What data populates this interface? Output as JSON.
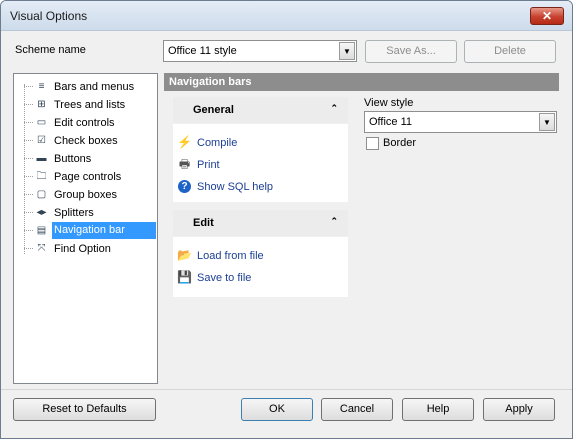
{
  "window": {
    "title": "Visual Options",
    "close_glyph": "✕"
  },
  "scheme": {
    "label": "Scheme name",
    "value": "Office 11 style",
    "save_as_label": "Save As...",
    "delete_label": "Delete"
  },
  "tree": {
    "items": [
      {
        "label": "Bars and menus",
        "icon": "bars-menus-icon",
        "glyph": "≡"
      },
      {
        "label": "Trees and lists",
        "icon": "tree-list-icon",
        "glyph": "⊞"
      },
      {
        "label": "Edit controls",
        "icon": "edit-control-icon",
        "glyph": "▭"
      },
      {
        "label": "Check boxes",
        "icon": "checkbox-icon",
        "glyph": "☑"
      },
      {
        "label": "Buttons",
        "icon": "button-icon",
        "glyph": "▬"
      },
      {
        "label": "Page controls",
        "icon": "page-control-icon",
        "glyph": "🗀"
      },
      {
        "label": "Group boxes",
        "icon": "group-box-icon",
        "glyph": "▢"
      },
      {
        "label": "Splitters",
        "icon": "splitter-icon",
        "glyph": "◂▸"
      },
      {
        "label": "Navigation bar",
        "icon": "navigation-bar-icon",
        "glyph": "▤"
      },
      {
        "label": "Find Option",
        "icon": "find-option-icon",
        "glyph": "⤧"
      }
    ],
    "selected_index": 8
  },
  "navigation": {
    "header": "Navigation bars",
    "groups": [
      {
        "title": "General",
        "collapse_glyph": "⌃",
        "items": [
          {
            "label": "Compile",
            "icon": "compile-icon",
            "glyph": "⚡",
            "color": "#e0a800"
          },
          {
            "label": "Print",
            "icon": "printer-icon",
            "glyph": "🖶",
            "color": "#555555"
          },
          {
            "label": "Show SQL help",
            "icon": "help-icon",
            "glyph": "?",
            "color": "#1e63c8"
          }
        ]
      },
      {
        "title": "Edit",
        "collapse_glyph": "⌃",
        "items": [
          {
            "label": "Load from file",
            "icon": "open-folder-icon",
            "glyph": "📂",
            "color": "#d4a020"
          },
          {
            "label": "Save to file",
            "icon": "save-icon",
            "glyph": "💾",
            "color": "#2a4fb0"
          }
        ]
      }
    ]
  },
  "view_style": {
    "label": "View style",
    "value": "Office 11",
    "border_label": "Border",
    "border_checked": false
  },
  "footer": {
    "reset_label": "Reset to Defaults",
    "ok_label": "OK",
    "cancel_label": "Cancel",
    "help_label": "Help",
    "apply_label": "Apply"
  },
  "colors": {
    "selection": "#3399ff",
    "link": "#1c3f94",
    "header_bar": "#8d8d8d"
  }
}
